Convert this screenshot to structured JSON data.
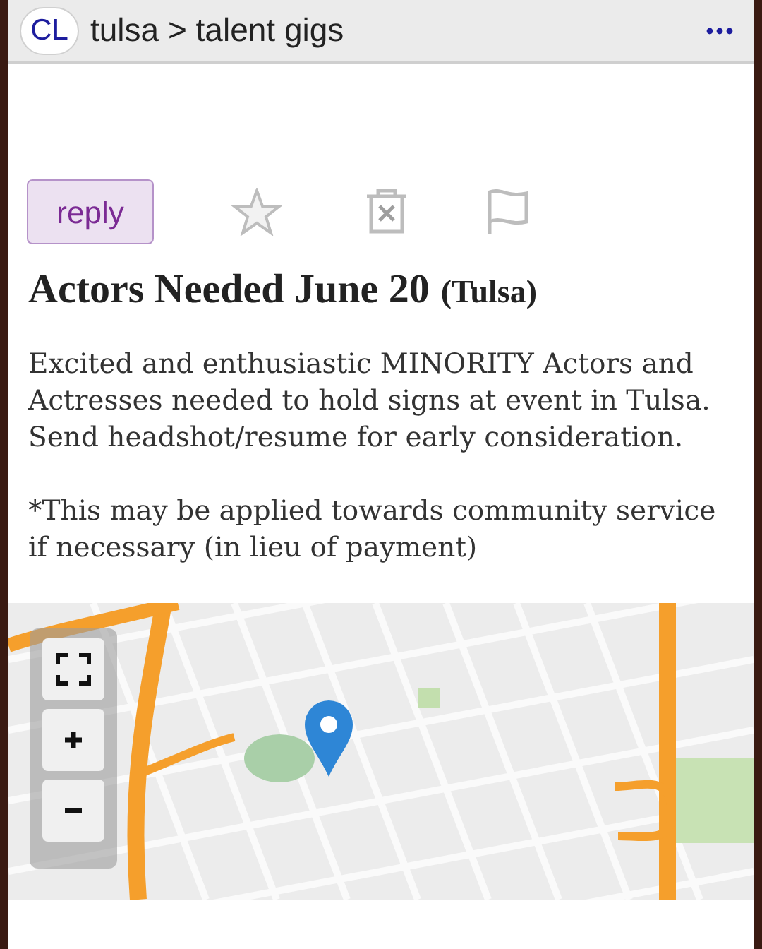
{
  "header": {
    "logo": "CL",
    "breadcrumb": "tulsa > talent gigs"
  },
  "actions": {
    "reply": "reply"
  },
  "posting": {
    "title": "Actors Needed June 20",
    "location": "(Tulsa)",
    "paragraphs": [
      "Excited and enthusiastic MINORITY Actors and Actresses needed to hold signs at event in Tulsa. Send headshot/resume for early consideration.",
      "*This may be applied towards community service if necessary (in lieu of payment)"
    ]
  }
}
